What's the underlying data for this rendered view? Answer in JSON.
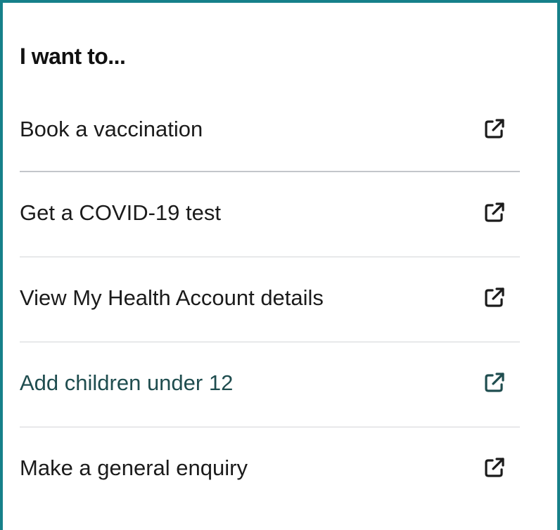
{
  "panel": {
    "heading": "I want to..."
  },
  "links": [
    {
      "label": "Book a vaccination",
      "icon": "external-link-icon"
    },
    {
      "label": "Get a COVID-19 test",
      "icon": "external-link-icon"
    },
    {
      "label": "View My Health Account details",
      "icon": "external-link-icon"
    },
    {
      "label": "Add children under 12",
      "icon": "external-link-icon"
    },
    {
      "label": "Make a general enquiry",
      "icon": "external-link-icon"
    }
  ],
  "colors": {
    "border": "#16808a",
    "text": "#1b1b1b",
    "hover_text": "#1f4d4f",
    "divider": "#d3d5d8"
  }
}
